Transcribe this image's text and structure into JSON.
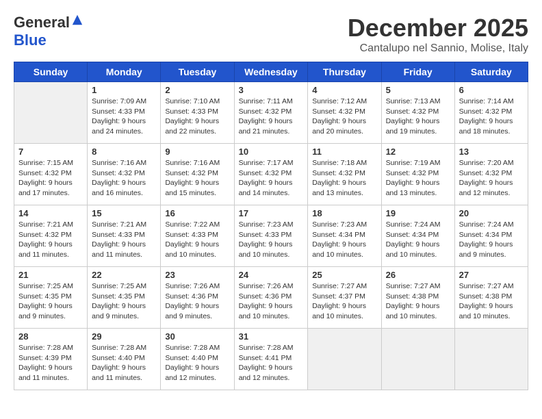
{
  "logo": {
    "general": "General",
    "blue": "Blue"
  },
  "title": "December 2025",
  "location": "Cantalupo nel Sannio, Molise, Italy",
  "headers": [
    "Sunday",
    "Monday",
    "Tuesday",
    "Wednesday",
    "Thursday",
    "Friday",
    "Saturday"
  ],
  "weeks": [
    [
      {
        "day": "",
        "empty": true
      },
      {
        "day": "1",
        "sunrise": "7:09 AM",
        "sunset": "4:33 PM",
        "daylight": "9 hours and 24 minutes."
      },
      {
        "day": "2",
        "sunrise": "7:10 AM",
        "sunset": "4:33 PM",
        "daylight": "9 hours and 22 minutes."
      },
      {
        "day": "3",
        "sunrise": "7:11 AM",
        "sunset": "4:32 PM",
        "daylight": "9 hours and 21 minutes."
      },
      {
        "day": "4",
        "sunrise": "7:12 AM",
        "sunset": "4:32 PM",
        "daylight": "9 hours and 20 minutes."
      },
      {
        "day": "5",
        "sunrise": "7:13 AM",
        "sunset": "4:32 PM",
        "daylight": "9 hours and 19 minutes."
      },
      {
        "day": "6",
        "sunrise": "7:14 AM",
        "sunset": "4:32 PM",
        "daylight": "9 hours and 18 minutes."
      }
    ],
    [
      {
        "day": "7",
        "sunrise": "7:15 AM",
        "sunset": "4:32 PM",
        "daylight": "9 hours and 17 minutes."
      },
      {
        "day": "8",
        "sunrise": "7:16 AM",
        "sunset": "4:32 PM",
        "daylight": "9 hours and 16 minutes."
      },
      {
        "day": "9",
        "sunrise": "7:16 AM",
        "sunset": "4:32 PM",
        "daylight": "9 hours and 15 minutes."
      },
      {
        "day": "10",
        "sunrise": "7:17 AM",
        "sunset": "4:32 PM",
        "daylight": "9 hours and 14 minutes."
      },
      {
        "day": "11",
        "sunrise": "7:18 AM",
        "sunset": "4:32 PM",
        "daylight": "9 hours and 13 minutes."
      },
      {
        "day": "12",
        "sunrise": "7:19 AM",
        "sunset": "4:32 PM",
        "daylight": "9 hours and 13 minutes."
      },
      {
        "day": "13",
        "sunrise": "7:20 AM",
        "sunset": "4:32 PM",
        "daylight": "9 hours and 12 minutes."
      }
    ],
    [
      {
        "day": "14",
        "sunrise": "7:21 AM",
        "sunset": "4:32 PM",
        "daylight": "9 hours and 11 minutes."
      },
      {
        "day": "15",
        "sunrise": "7:21 AM",
        "sunset": "4:33 PM",
        "daylight": "9 hours and 11 minutes."
      },
      {
        "day": "16",
        "sunrise": "7:22 AM",
        "sunset": "4:33 PM",
        "daylight": "9 hours and 10 minutes."
      },
      {
        "day": "17",
        "sunrise": "7:23 AM",
        "sunset": "4:33 PM",
        "daylight": "9 hours and 10 minutes."
      },
      {
        "day": "18",
        "sunrise": "7:23 AM",
        "sunset": "4:34 PM",
        "daylight": "9 hours and 10 minutes."
      },
      {
        "day": "19",
        "sunrise": "7:24 AM",
        "sunset": "4:34 PM",
        "daylight": "9 hours and 10 minutes."
      },
      {
        "day": "20",
        "sunrise": "7:24 AM",
        "sunset": "4:34 PM",
        "daylight": "9 hours and 9 minutes."
      }
    ],
    [
      {
        "day": "21",
        "sunrise": "7:25 AM",
        "sunset": "4:35 PM",
        "daylight": "9 hours and 9 minutes."
      },
      {
        "day": "22",
        "sunrise": "7:25 AM",
        "sunset": "4:35 PM",
        "daylight": "9 hours and 9 minutes."
      },
      {
        "day": "23",
        "sunrise": "7:26 AM",
        "sunset": "4:36 PM",
        "daylight": "9 hours and 9 minutes."
      },
      {
        "day": "24",
        "sunrise": "7:26 AM",
        "sunset": "4:36 PM",
        "daylight": "9 hours and 10 minutes."
      },
      {
        "day": "25",
        "sunrise": "7:27 AM",
        "sunset": "4:37 PM",
        "daylight": "9 hours and 10 minutes."
      },
      {
        "day": "26",
        "sunrise": "7:27 AM",
        "sunset": "4:38 PM",
        "daylight": "9 hours and 10 minutes."
      },
      {
        "day": "27",
        "sunrise": "7:27 AM",
        "sunset": "4:38 PM",
        "daylight": "9 hours and 10 minutes."
      }
    ],
    [
      {
        "day": "28",
        "sunrise": "7:28 AM",
        "sunset": "4:39 PM",
        "daylight": "9 hours and 11 minutes."
      },
      {
        "day": "29",
        "sunrise": "7:28 AM",
        "sunset": "4:40 PM",
        "daylight": "9 hours and 11 minutes."
      },
      {
        "day": "30",
        "sunrise": "7:28 AM",
        "sunset": "4:40 PM",
        "daylight": "9 hours and 12 minutes."
      },
      {
        "day": "31",
        "sunrise": "7:28 AM",
        "sunset": "4:41 PM",
        "daylight": "9 hours and 12 minutes."
      },
      {
        "day": "",
        "empty": true
      },
      {
        "day": "",
        "empty": true
      },
      {
        "day": "",
        "empty": true
      }
    ]
  ],
  "labels": {
    "sunrise": "Sunrise:",
    "sunset": "Sunset:",
    "daylight": "Daylight:"
  }
}
